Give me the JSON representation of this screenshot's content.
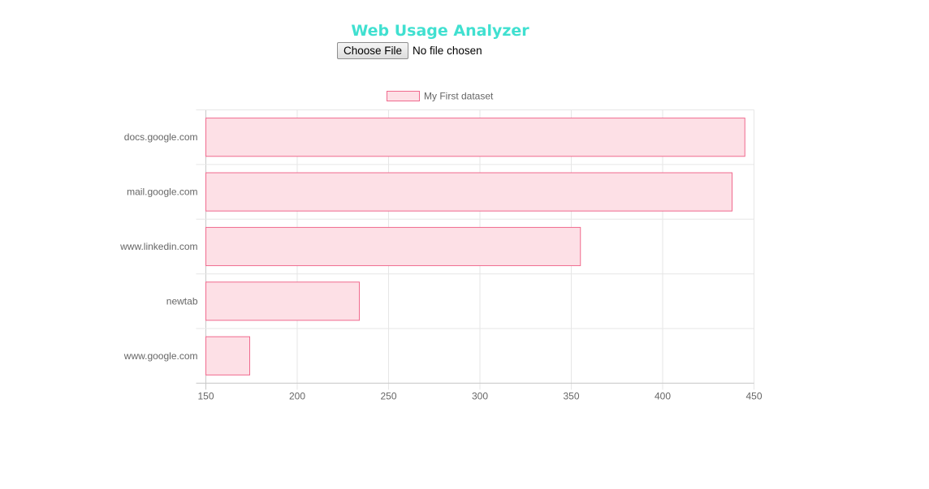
{
  "header": {
    "title": "Web Usage Analyzer",
    "title_color": "#40e0d0"
  },
  "file_input": {
    "button_label": "Choose File",
    "status_text": "No file chosen"
  },
  "chart_data": {
    "type": "bar",
    "orientation": "horizontal",
    "categories": [
      "docs.google.com",
      "mail.google.com",
      "www.linkedin.com",
      "newtab",
      "www.google.com"
    ],
    "series": [
      {
        "name": "My First dataset",
        "values": [
          445,
          438,
          355,
          234,
          174
        ],
        "fill_color": "#fde0e6",
        "border_color": "#f06a8e"
      }
    ],
    "x_ticks": [
      150,
      200,
      250,
      300,
      350,
      400,
      450
    ],
    "xlim": [
      150,
      450
    ],
    "grid": true,
    "legend_position": "top"
  }
}
